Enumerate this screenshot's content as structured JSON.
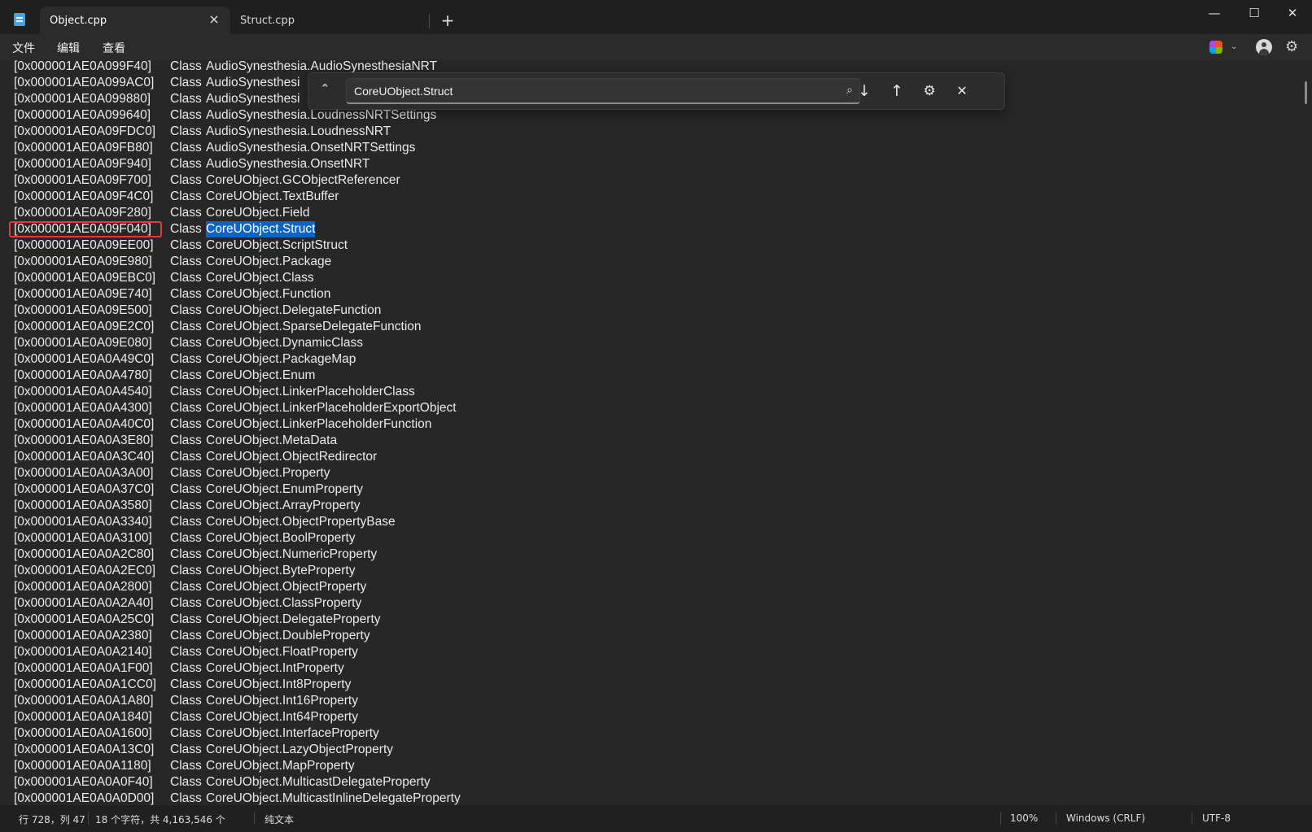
{
  "tabs": [
    {
      "label": "Object.cpp",
      "active": true
    },
    {
      "label": "Struct.cpp",
      "active": false
    }
  ],
  "icons": {
    "close_tab": "×",
    "new_tab": "+",
    "minimize": "—",
    "maximize": "☐",
    "close_window": "✕",
    "find_toggle": "⌃",
    "search": "⌕",
    "next": "↓",
    "prev": "↑",
    "options": "⚙",
    "find_close": "✕",
    "chevron": "⌄",
    "gear": "⚙"
  },
  "menu": [
    "文件",
    "编辑",
    "查看"
  ],
  "find": {
    "query": "CoreUObject.Struct"
  },
  "lines": [
    {
      "addr": "[0x000001AE0A099F40]",
      "cls": "Class",
      "name": "AudioSynesthesia.AudioSynesthesiaNRT"
    },
    {
      "addr": "[0x000001AE0A099AC0]",
      "cls": "Class",
      "name": "AudioSynesthesi"
    },
    {
      "addr": "[0x000001AE0A099880]",
      "cls": "Class",
      "name": "AudioSynesthesi"
    },
    {
      "addr": "[0x000001AE0A099640]",
      "cls": "Class",
      "name": "AudioSynesthesia.LoudnessNRTSettings"
    },
    {
      "addr": "[0x000001AE0A09FDC0]",
      "cls": "Class",
      "name": "AudioSynesthesia.LoudnessNRT"
    },
    {
      "addr": "[0x000001AE0A09FB80]",
      "cls": "Class",
      "name": "AudioSynesthesia.OnsetNRTSettings"
    },
    {
      "addr": "[0x000001AE0A09F940]",
      "cls": "Class",
      "name": "AudioSynesthesia.OnsetNRT"
    },
    {
      "addr": "[0x000001AE0A09F700]",
      "cls": "Class",
      "name": "CoreUObject.GCObjectReferencer"
    },
    {
      "addr": "[0x000001AE0A09F4C0]",
      "cls": "Class",
      "name": "CoreUObject.TextBuffer"
    },
    {
      "addr": "[0x000001AE0A09F280]",
      "cls": "Class",
      "name": "CoreUObject.Field"
    },
    {
      "addr": "[0x000001AE0A09F040]",
      "cls": "Class",
      "name": "CoreUObject.Struct",
      "highlight": true
    },
    {
      "addr": "[0x000001AE0A09EE00]",
      "cls": "Class",
      "name": "CoreUObject.ScriptStruct"
    },
    {
      "addr": "[0x000001AE0A09E980]",
      "cls": "Class",
      "name": "CoreUObject.Package"
    },
    {
      "addr": "[0x000001AE0A09EBC0]",
      "cls": "Class",
      "name": "CoreUObject.Class"
    },
    {
      "addr": "[0x000001AE0A09E740]",
      "cls": "Class",
      "name": "CoreUObject.Function"
    },
    {
      "addr": "[0x000001AE0A09E500]",
      "cls": "Class",
      "name": "CoreUObject.DelegateFunction"
    },
    {
      "addr": "[0x000001AE0A09E2C0]",
      "cls": "Class",
      "name": "CoreUObject.SparseDelegateFunction"
    },
    {
      "addr": "[0x000001AE0A09E080]",
      "cls": "Class",
      "name": "CoreUObject.DynamicClass"
    },
    {
      "addr": "[0x000001AE0A0A49C0]",
      "cls": "Class",
      "name": "CoreUObject.PackageMap"
    },
    {
      "addr": "[0x000001AE0A0A4780]",
      "cls": "Class",
      "name": "CoreUObject.Enum"
    },
    {
      "addr": "[0x000001AE0A0A4540]",
      "cls": "Class",
      "name": "CoreUObject.LinkerPlaceholderClass"
    },
    {
      "addr": "[0x000001AE0A0A4300]",
      "cls": "Class",
      "name": "CoreUObject.LinkerPlaceholderExportObject"
    },
    {
      "addr": "[0x000001AE0A0A40C0]",
      "cls": "Class",
      "name": "CoreUObject.LinkerPlaceholderFunction"
    },
    {
      "addr": "[0x000001AE0A0A3E80]",
      "cls": "Class",
      "name": "CoreUObject.MetaData"
    },
    {
      "addr": "[0x000001AE0A0A3C40]",
      "cls": "Class",
      "name": "CoreUObject.ObjectRedirector"
    },
    {
      "addr": "[0x000001AE0A0A3A00]",
      "cls": "Class",
      "name": "CoreUObject.Property"
    },
    {
      "addr": "[0x000001AE0A0A37C0]",
      "cls": "Class",
      "name": "CoreUObject.EnumProperty"
    },
    {
      "addr": "[0x000001AE0A0A3580]",
      "cls": "Class",
      "name": "CoreUObject.ArrayProperty"
    },
    {
      "addr": "[0x000001AE0A0A3340]",
      "cls": "Class",
      "name": "CoreUObject.ObjectPropertyBase"
    },
    {
      "addr": "[0x000001AE0A0A3100]",
      "cls": "Class",
      "name": "CoreUObject.BoolProperty"
    },
    {
      "addr": "[0x000001AE0A0A2C80]",
      "cls": "Class",
      "name": "CoreUObject.NumericProperty"
    },
    {
      "addr": "[0x000001AE0A0A2EC0]",
      "cls": "Class",
      "name": "CoreUObject.ByteProperty"
    },
    {
      "addr": "[0x000001AE0A0A2800]",
      "cls": "Class",
      "name": "CoreUObject.ObjectProperty"
    },
    {
      "addr": "[0x000001AE0A0A2A40]",
      "cls": "Class",
      "name": "CoreUObject.ClassProperty"
    },
    {
      "addr": "[0x000001AE0A0A25C0]",
      "cls": "Class",
      "name": "CoreUObject.DelegateProperty"
    },
    {
      "addr": "[0x000001AE0A0A2380]",
      "cls": "Class",
      "name": "CoreUObject.DoubleProperty"
    },
    {
      "addr": "[0x000001AE0A0A2140]",
      "cls": "Class",
      "name": "CoreUObject.FloatProperty"
    },
    {
      "addr": "[0x000001AE0A0A1F00]",
      "cls": "Class",
      "name": "CoreUObject.IntProperty"
    },
    {
      "addr": "[0x000001AE0A0A1CC0]",
      "cls": "Class",
      "name": "CoreUObject.Int8Property"
    },
    {
      "addr": "[0x000001AE0A0A1A80]",
      "cls": "Class",
      "name": "CoreUObject.Int16Property"
    },
    {
      "addr": "[0x000001AE0A0A1840]",
      "cls": "Class",
      "name": "CoreUObject.Int64Property"
    },
    {
      "addr": "[0x000001AE0A0A1600]",
      "cls": "Class",
      "name": "CoreUObject.InterfaceProperty"
    },
    {
      "addr": "[0x000001AE0A0A13C0]",
      "cls": "Class",
      "name": "CoreUObject.LazyObjectProperty"
    },
    {
      "addr": "[0x000001AE0A0A1180]",
      "cls": "Class",
      "name": "CoreUObject.MapProperty"
    },
    {
      "addr": "[0x000001AE0A0A0F40]",
      "cls": "Class",
      "name": "CoreUObject.MulticastDelegateProperty"
    },
    {
      "addr": "[0x000001AE0A0A0D00]",
      "cls": "Class",
      "name": "CoreUObject.MulticastInlineDelegateProperty"
    }
  ],
  "status": {
    "position": "行 728，列 47",
    "selection": "18 个字符，共 4,163,546 个",
    "format": "纯文本",
    "zoom": "100%",
    "line_ending": "Windows (CRLF)",
    "encoding": "UTF-8"
  },
  "colors": {
    "background": "#272727",
    "selection_highlight": "#0e63c3",
    "annotation_box": "#e23a3a"
  }
}
